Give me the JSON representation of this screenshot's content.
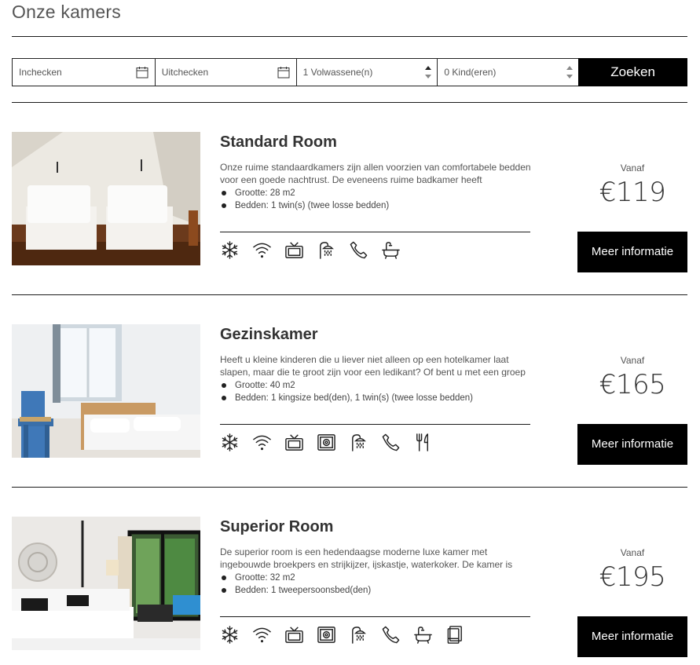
{
  "page": {
    "title": "Onze kamers"
  },
  "search": {
    "checkin_placeholder": "Inchecken",
    "checkout_placeholder": "Uitchecken",
    "adults_value": "1 Volwassene(n)",
    "children_value": "0 Kind(eren)",
    "button_label": "Zoeken"
  },
  "rooms": [
    {
      "name": "Standard Room",
      "description": "Onze ruime standaardkamers zijn allen voorzien van comfortabele bedden voor een goede nachtrust. De eveneens ruime badkamer heeft",
      "specs": [
        "Grootte: 28 m2",
        "Bedden: 1 twin(s) (twee losse bedden)"
      ],
      "amenities": [
        "snowflake-icon",
        "wifi-icon",
        "tv-icon",
        "shower-icon",
        "phone-icon",
        "bathtub-icon"
      ],
      "from_label": "Vanaf",
      "price": "€119",
      "more_label": "Meer informatie"
    },
    {
      "name": "Gezinskamer",
      "description": "Heeft u kleine kinderen die u liever niet alleen op een hotelkamer laat slapen, maar die te groot zijn voor een ledikant? Of bent u met een groep",
      "specs": [
        "Grootte: 40 m2",
        "Bedden: 1 kingsize bed(den), 1 twin(s) (twee losse bedden)"
      ],
      "amenities": [
        "snowflake-icon",
        "wifi-icon",
        "tv-icon",
        "safe-icon",
        "shower-icon",
        "phone-icon",
        "cutlery-icon"
      ],
      "from_label": "Vanaf",
      "price": "€165",
      "more_label": "Meer informatie"
    },
    {
      "name": "Superior Room",
      "description": "De superior room is een hedendaagse moderne luxe kamer met ingebouwde broekpers en strijkijzer, ijskastje, waterkoker. De kamer is",
      "specs": [
        "Grootte: 32 m2",
        "Bedden: 1 tweepersoonsbed(den)"
      ],
      "amenities": [
        "snowflake-icon",
        "wifi-icon",
        "tv-icon",
        "safe-icon",
        "shower-icon",
        "phone-icon",
        "bathtub-icon",
        "towel-icon"
      ],
      "from_label": "Vanaf",
      "price": "€195",
      "more_label": "Meer informatie"
    }
  ]
}
